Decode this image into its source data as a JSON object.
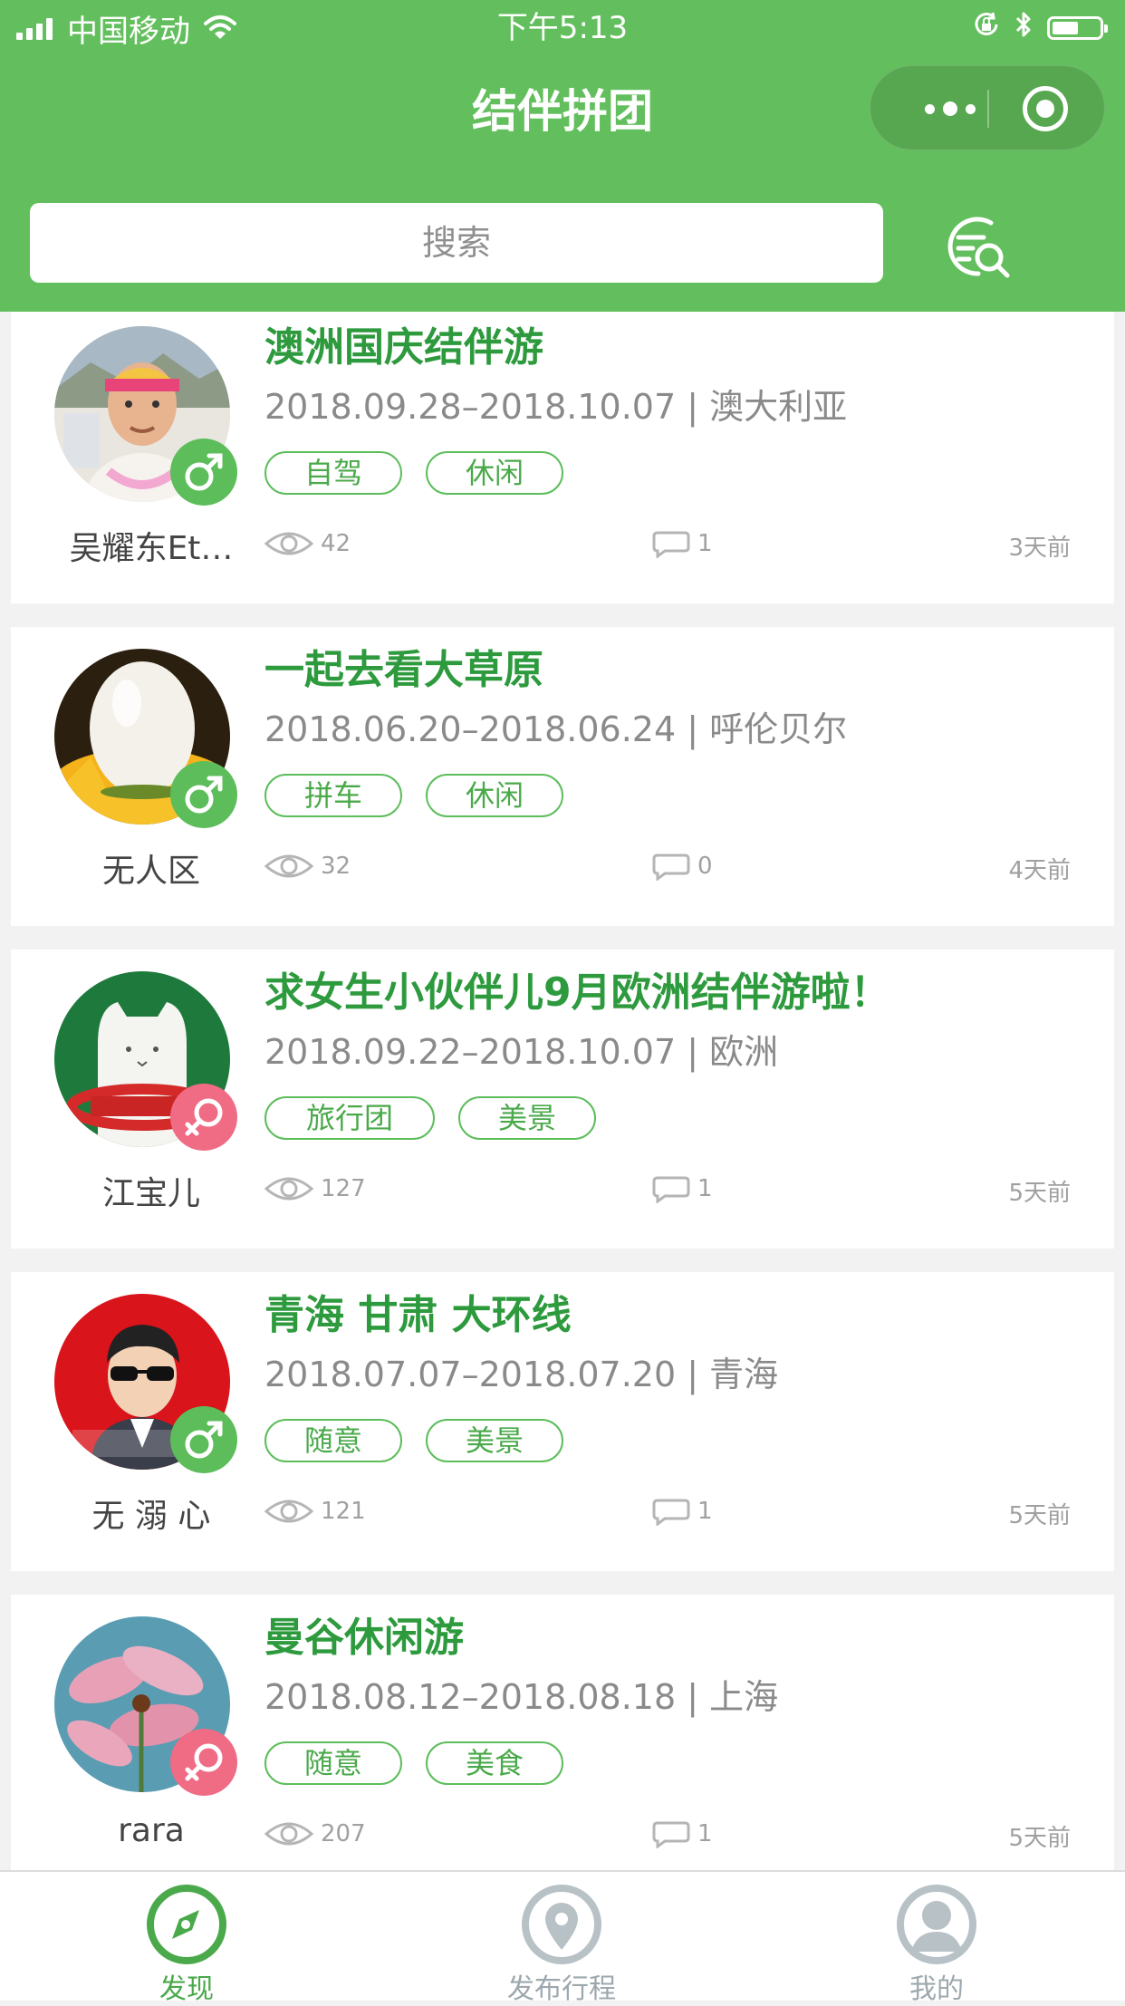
{
  "status_bar": {
    "carrier": "中国移动",
    "time": "下午5:13"
  },
  "nav": {
    "title": "结伴拼团",
    "more_icon": "more-dots-icon",
    "close_icon": "target-close-icon"
  },
  "search": {
    "placeholder": "搜索",
    "button_icon": "search-filter-icon"
  },
  "colors": {
    "brand_green": "#63bf5d",
    "title_green": "#2e9a3e",
    "male": "#5cbd5a",
    "female": "#f06b84"
  },
  "trips": [
    {
      "user": "吴耀东Et…",
      "gender": "male",
      "title": "澳洲国庆结伴游",
      "date": "2018.09.28–2018.10.07 | 澳大利亚",
      "tags": [
        "自驾",
        "休闲"
      ],
      "views": "42",
      "comments": "1",
      "time_ago": "3天前"
    },
    {
      "user": "无人区",
      "gender": "male",
      "title": "一起去看大草原",
      "date": "2018.06.20–2018.06.24 | 呼伦贝尔",
      "tags": [
        "拼车",
        "休闲"
      ],
      "views": "32",
      "comments": "0",
      "time_ago": "4天前"
    },
    {
      "user": "江宝儿",
      "gender": "female",
      "title": "求女生小伙伴儿9月欧洲结伴游啦！",
      "date": "2018.09.22–2018.10.07 | 欧洲",
      "tags": [
        "旅行团",
        "美景"
      ],
      "views": "127",
      "comments": "1",
      "time_ago": "5天前"
    },
    {
      "user": "无 溺 心",
      "gender": "male",
      "title": "青海 甘肃 大环线",
      "date": "2018.07.07–2018.07.20 | 青海",
      "tags": [
        "随意",
        "美景"
      ],
      "views": "121",
      "comments": "1",
      "time_ago": "5天前"
    },
    {
      "user": "rara",
      "gender": "female",
      "title": "曼谷休闲游",
      "date": "2018.08.12–2018.08.18 | 上海",
      "tags": [
        "随意",
        "美食"
      ],
      "views": "207",
      "comments": "1",
      "time_ago": "5天前"
    }
  ],
  "tabbar": {
    "tabs": [
      {
        "label": "发现",
        "icon": "compass-icon",
        "active": true
      },
      {
        "label": "发布行程",
        "icon": "location-pin-icon",
        "active": false
      },
      {
        "label": "我的",
        "icon": "user-profile-icon",
        "active": false
      }
    ]
  }
}
